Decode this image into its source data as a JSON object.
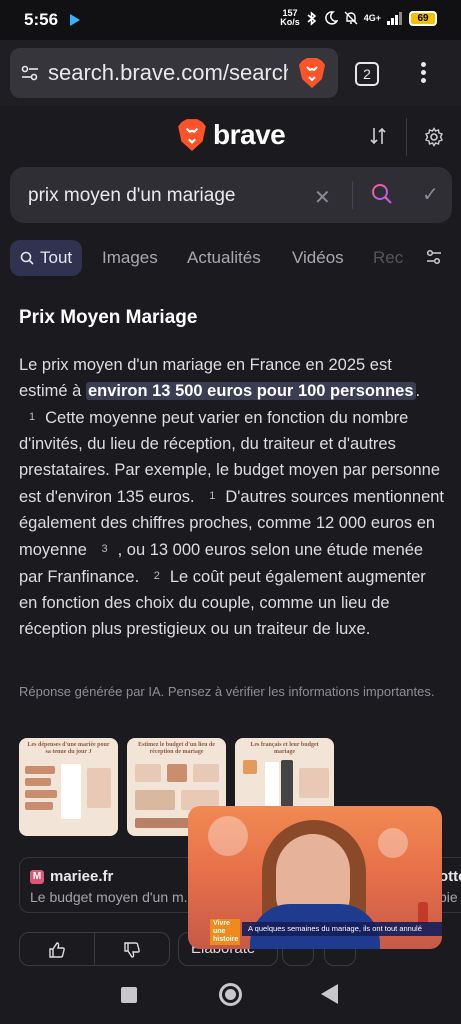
{
  "status": {
    "time": "5:56",
    "net_speed_value": "157",
    "net_speed_unit": "Ko/s",
    "network": "4G+",
    "battery": "69"
  },
  "browser": {
    "url": "search.brave.com/search",
    "tab_count": "2"
  },
  "brand": {
    "name": "brave",
    "accent": "#fb542b"
  },
  "search": {
    "query": "prix moyen d'un mariage",
    "clear_label": "✕",
    "submit_label": "✓"
  },
  "tabs": [
    {
      "label": "Tout",
      "active": true
    },
    {
      "label": "Images"
    },
    {
      "label": "Actualités"
    },
    {
      "label": "Vidéos"
    },
    {
      "label": "Rec"
    }
  ],
  "answer": {
    "title": "Prix Moyen Mariage",
    "p1": "Le prix moyen d'un mariage en France en 2025 est estimé à ",
    "highlight": "environ 13 500 euros pour 100 personnes",
    "p1_end": ".",
    "cite1": "1",
    "p2": "Cette moyenne peut varier en fonction du nombre d'invités, du lieu de réception, du traiteur et d'autres prestataires. Par exemple, le budget moyen par personne est d'environ 135 euros.",
    "cite2": "1",
    "p3": "D'autres sources mentionnent également des chiffres proches, comme 12 000 euros en moyenne",
    "cite3": "3",
    "p4": ", ou 13 000 euros selon une étude menée par Franfinance.",
    "cite4": "2",
    "p5": "Le coût peut également augmenter en fonction des choix du couple, comme un lieu de réception plus prestigieux ou un traiteur de luxe.",
    "disclaimer": "Réponse générée par IA. Pensez à vérifier les informations importantes."
  },
  "images": [
    {
      "caption": "Les dépenses d'une mariée pour sa tenue du jour J"
    },
    {
      "caption": "Estimez le budget d'un lieu de réception de mariage"
    },
    {
      "caption": "Les français et leur budget mariage"
    }
  ],
  "sources": [
    {
      "favicon": "M",
      "domain": "mariee.fr",
      "desc": "Le budget moyen d'un m..."
    },
    {
      "domain": "ottc",
      "desc": "bie"
    }
  ],
  "actions": {
    "elaborate": "Elaborate"
  },
  "video": {
    "tag": "Vivre une histoire",
    "caption": "A quelques semaines du mariage, ils ont tout annulé"
  }
}
